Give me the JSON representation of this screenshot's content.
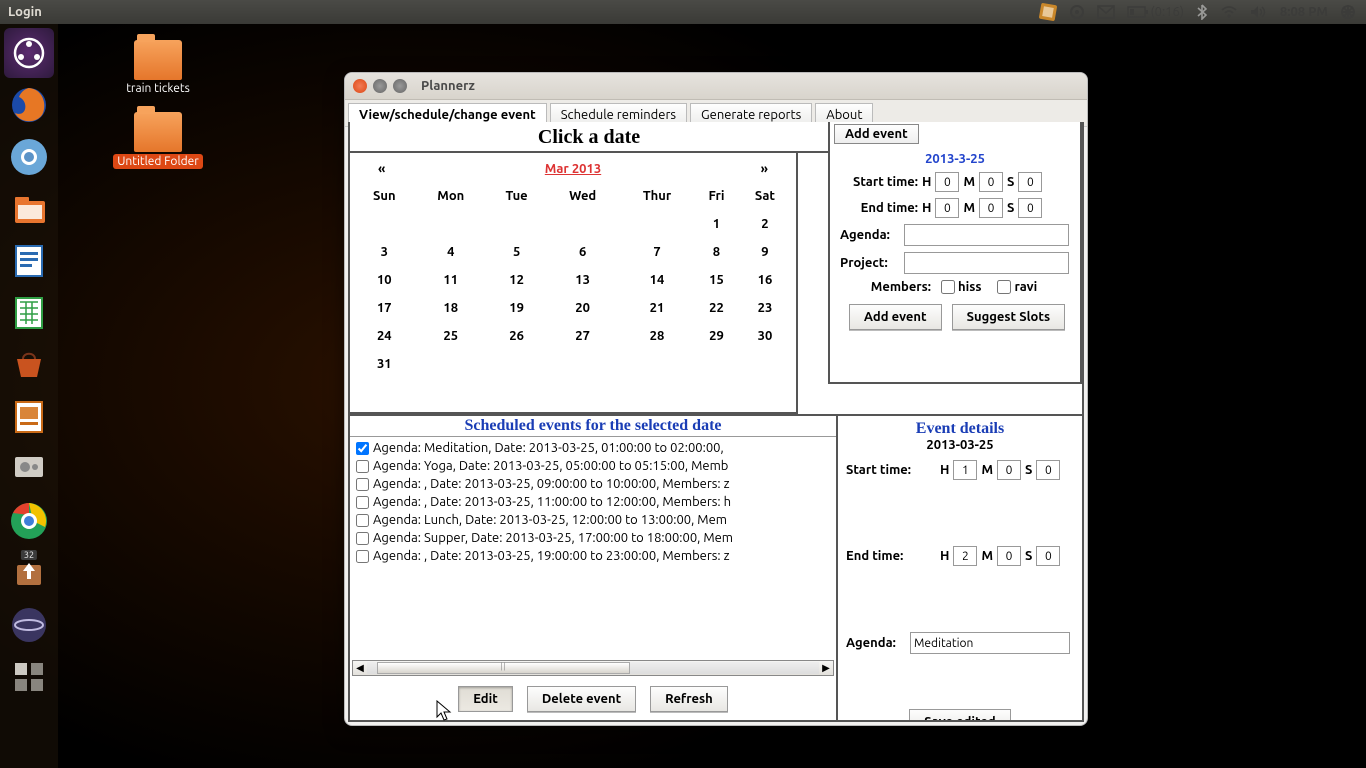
{
  "top_panel": {
    "left_label": "Login",
    "battery": "(0:16)",
    "time": "8:08 PM"
  },
  "desktop": {
    "icon1_label": "train tickets",
    "icon2_label": "Untitled Folder"
  },
  "launcher": {
    "badge": "32"
  },
  "window": {
    "title": "Plannerz",
    "tabs": {
      "view": "View/schedule/change event",
      "reminders": "Schedule reminders",
      "reports": "Generate reports",
      "about": "About"
    },
    "click_title": "Click a date",
    "calendar": {
      "prev": "«",
      "next": "»",
      "month": "Mar 2013",
      "dow": {
        "sun": "Sun",
        "mon": "Mon",
        "tue": "Tue",
        "wed": "Wed",
        "thu": "Thur",
        "fri": "Fri",
        "sat": "Sat"
      },
      "cells": {
        "r1c5": "1",
        "r1c6": "2",
        "r2c0": "3",
        "r2c1": "4",
        "r2c2": "5",
        "r2c3": "6",
        "r2c4": "7",
        "r2c5": "8",
        "r2c6": "9",
        "r3c0": "10",
        "r3c1": "11",
        "r3c2": "12",
        "r3c3": "13",
        "r3c4": "14",
        "r3c5": "15",
        "r3c6": "16",
        "r4c0": "17",
        "r4c1": "18",
        "r4c2": "19",
        "r4c3": "20",
        "r4c4": "21",
        "r4c5": "22",
        "r4c6": "23",
        "r5c0": "24",
        "r5c1": "25",
        "r5c2": "26",
        "r5c3": "27",
        "r5c4": "28",
        "r5c5": "29",
        "r5c6": "30",
        "r6c0": "31"
      }
    },
    "add_event": {
      "tab_label": "Add event",
      "date": "2013-3-25",
      "start_label": "Start time:",
      "end_label": "End time:",
      "h": "H",
      "m": "M",
      "s": "S",
      "start_h": "0",
      "start_m": "0",
      "start_s": "0",
      "end_h": "0",
      "end_m": "0",
      "end_s": "0",
      "agenda_label": "Agenda:",
      "project_label": "Project:",
      "members_label": "Members:",
      "member1": "hiss",
      "member2": "ravi",
      "btn_add": "Add event",
      "btn_suggest": "Suggest Slots"
    },
    "scheduled": {
      "title": "Scheduled events for the selected date",
      "items": {
        "i0": "Agenda: Meditation, Date: 2013-03-25, 01:00:00 to 02:00:00, ",
        "i1": "Agenda: Yoga, Date: 2013-03-25, 05:00:00 to 05:15:00, Memb",
        "i2": "Agenda: , Date: 2013-03-25, 09:00:00 to 10:00:00, Members: z",
        "i3": "Agenda: , Date: 2013-03-25, 11:00:00 to 12:00:00, Members: h",
        "i4": "Agenda: Lunch, Date: 2013-03-25, 12:00:00 to 13:00:00, Mem",
        "i5": "Agenda: Supper, Date: 2013-03-25, 17:00:00 to 18:00:00, Mem",
        "i6": "Agenda: , Date: 2013-03-25, 19:00:00 to 23:00:00, Members: z"
      },
      "btn_edit": "Edit",
      "btn_delete": "Delete event",
      "btn_refresh": "Refresh"
    },
    "details": {
      "title": "Event details",
      "date": "2013-03-25",
      "start_label": "Start time:",
      "end_label": "End time:",
      "h": "H",
      "m": "M",
      "s": "S",
      "start_h": "1",
      "start_m": "0",
      "start_s": "0",
      "end_h": "2",
      "end_m": "0",
      "end_s": "0",
      "agenda_label": "Agenda:",
      "agenda_value": "Meditation",
      "btn_save": "Save edited"
    }
  }
}
